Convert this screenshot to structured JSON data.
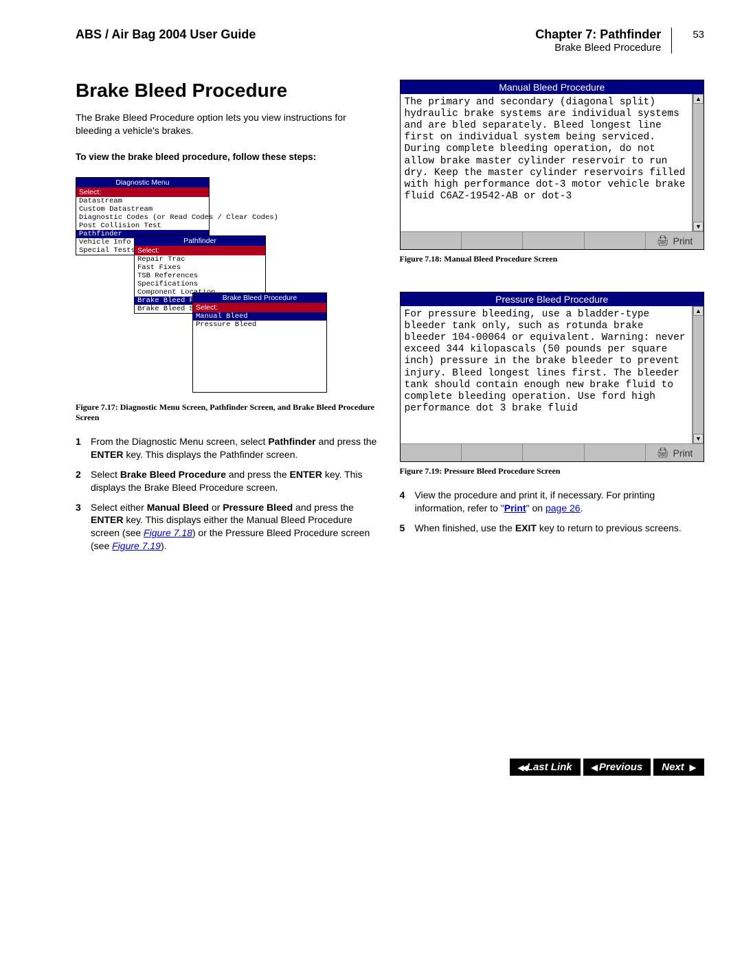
{
  "header": {
    "guide_title": "ABS / Air Bag 2004 User Guide",
    "chapter": "Chapter 7: Pathfinder",
    "section": "Brake Bleed Procedure",
    "page_number": "53"
  },
  "title": "Brake Bleed Procedure",
  "intro": "The Brake Bleed Procedure option lets you view instructions for bleeding a vehicle's brakes.",
  "steps_lead": "To view the brake bleed procedure, follow these steps:",
  "diag_menu": {
    "title": "Diagnostic Menu",
    "select": "Select:",
    "items": [
      "Datastream",
      "Custom Datastream",
      "Diagnostic Codes  (or Read Codes / Clear Codes)",
      "Post Collision Test",
      "Pathfinder",
      "Vehicle Info",
      "Special Tests"
    ]
  },
  "pathfinder_menu": {
    "title": "Pathfinder",
    "select": "Select:",
    "items": [
      "Repair Trac",
      "Fast Fixes",
      "TSB References",
      "Specifications",
      "Component Location",
      "Brake Bleed Proced",
      "Brake Bleed Sequen"
    ]
  },
  "bbp_menu": {
    "title": "Brake Bleed Procedure",
    "select": "Select:",
    "items": [
      "Manual Bleed",
      "Pressure Bleed"
    ]
  },
  "fig17_caption": "Figure 7.17: Diagnostic Menu Screen, Pathfinder Screen, and Brake Bleed Procedure Screen",
  "steps": {
    "s1a": "From the Diagnostic Menu screen, select ",
    "s1b": "Pathfinder",
    "s1c": " and press the ",
    "s1d": "ENTER",
    "s1e": " key. This displays the Pathfinder screen.",
    "s2a": "Select ",
    "s2b": "Brake Bleed Procedure",
    "s2c": " and press the ",
    "s2d": "ENTER",
    "s2e": " key. This displays the Brake Bleed Procedure screen.",
    "s3a": "Select either ",
    "s3b": "Manual Bleed",
    "s3c": " or ",
    "s3d": "Pressure Bleed",
    "s3e": " and press the ",
    "s3f": "ENTER",
    "s3g": " key. This displays either the Manual Bleed Procedure screen (see ",
    "s3h": "Figure 7.18",
    "s3i": ") or the Pressure Bleed Procedure screen (see ",
    "s3j": "Figure 7.19",
    "s3k": ").",
    "s4a": "View the procedure and print it, if necessary. For printing information, refer to \"",
    "s4b": "Print",
    "s4c": "\" on ",
    "s4d": "page 26",
    "s4e": ".",
    "s5a": "When finished, use the ",
    "s5b": "EXIT",
    "s5c": " key to return to previous screens."
  },
  "manual_bleed": {
    "title": "Manual Bleed Procedure",
    "text": "The primary and secondary (diagonal split) hydraulic brake systems are individual systems and are bled separately. Bleed longest line first on individual system being serviced. During complete bleeding operation, do not allow brake master cylinder reservoir to run dry. Keep the master cylinder reservoirs filled with high performance dot-3 motor vehicle brake fluid C6AZ-19542-AB or dot-3",
    "print": "Print"
  },
  "fig18_caption": "Figure 7.18: Manual Bleed Procedure Screen",
  "pressure_bleed": {
    "title": "Pressure Bleed Procedure",
    "text": "For pressure bleeding, use a bladder-type bleeder tank only, such as rotunda brake bleeder 104-00064 or equivalent. Warning: never exceed 344 kilopascals (50 pounds per square inch) pressure in the brake bleeder to prevent injury. Bleed longest lines first. The bleeder tank should contain enough new brake fluid to complete bleeding operation. Use ford high performance dot 3 brake fluid",
    "print": "Print"
  },
  "fig19_caption": "Figure 7.19: Pressure Bleed Procedure Screen",
  "nav": {
    "last_link": "Last Link",
    "previous": "Previous",
    "next": "Next"
  }
}
